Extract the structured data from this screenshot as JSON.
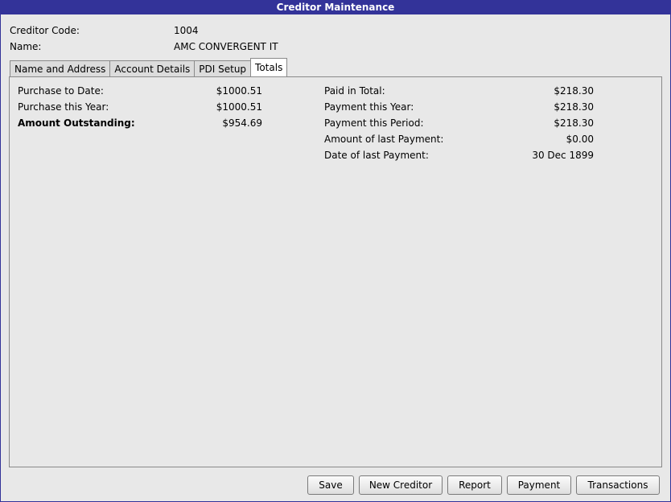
{
  "window": {
    "title": "Creditor Maintenance"
  },
  "header": {
    "code_label": "Creditor Code:",
    "code_value": "1004",
    "name_label": "Name:",
    "name_value": "AMC CONVERGENT IT"
  },
  "tabs": [
    {
      "label": "Name and Address",
      "active": false
    },
    {
      "label": "Account Details",
      "active": false
    },
    {
      "label": "PDI Setup",
      "active": false
    },
    {
      "label": "Totals",
      "active": true
    }
  ],
  "totals": {
    "left": [
      {
        "label": "Purchase to Date:",
        "value": "$1000.51"
      },
      {
        "label": "Purchase this Year:",
        "value": "$1000.51"
      },
      {
        "label": "Amount Outstanding:",
        "value": "$954.69"
      }
    ],
    "right": [
      {
        "label": "Paid in Total:",
        "value": "$218.30"
      },
      {
        "label": "Payment this Year:",
        "value": "$218.30"
      },
      {
        "label": "Payment this Period:",
        "value": "$218.30"
      },
      {
        "label": "Amount of last Payment:",
        "value": "$0.00"
      },
      {
        "label": "Date of last Payment:",
        "value": "30 Dec 1899"
      }
    ]
  },
  "buttons": {
    "save": "Save",
    "new_creditor": "New Creditor",
    "report": "Report",
    "payment": "Payment",
    "transactions": "Transactions"
  },
  "colors": {
    "title_bar": "#333399",
    "window_bg": "#e8e8e8"
  }
}
